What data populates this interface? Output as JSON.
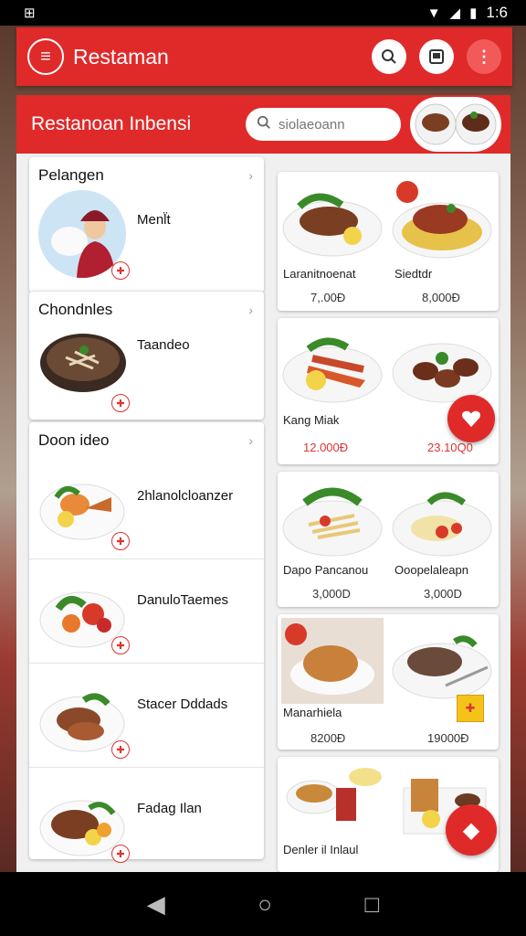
{
  "status": {
    "time": "1:6",
    "left_icon": "app-notification-icon"
  },
  "appbar": {
    "title": "Restaman"
  },
  "header": {
    "title": "Restanoan Inbensi",
    "search_placeholder": "siolaeoann"
  },
  "categories": [
    {
      "title": "Pelangen",
      "items": [
        {
          "name": "Menl̈t",
          "icon": "woman-with-rice-icon"
        }
      ]
    },
    {
      "title": "Chondnles",
      "items": [
        {
          "name": "Taandeo",
          "icon": "noodle-bowl-icon"
        }
      ]
    },
    {
      "title": "Doon ideo",
      "items": [
        {
          "name": "2hlanolcloanzer",
          "icon": "fried-fish-plate-icon"
        },
        {
          "name": "DanuloTaemes",
          "icon": "vegetable-plate-icon"
        },
        {
          "name": "Stacer Dddads",
          "icon": "grilled-meat-plate-icon"
        },
        {
          "name": "Fadag Ilan",
          "icon": "steak-plate-icon"
        }
      ]
    }
  ],
  "grid": [
    {
      "left": "Laranitnoenat",
      "right": "Siedtdr",
      "price_left": "7,.00Đ",
      "price_right": "8,000Đ"
    },
    {
      "left": "Kang Miak",
      "right": "",
      "price_left": "12.000Đ",
      "price_right": "23.10Q0"
    },
    {
      "left": "Dapo Pancanou",
      "right": "Ooopelaleapn",
      "price_left": "3,000D",
      "price_right": "3,000D"
    },
    {
      "left": "Manarhiela",
      "right": "",
      "price_left": "8200Đ",
      "price_right": "19000Đ"
    },
    {
      "left": "Denler il Inlaul",
      "right": "",
      "price_left": "",
      "price_right": ""
    }
  ],
  "colors": {
    "brand": "#e02a2a",
    "price_accent": "#d33333"
  }
}
